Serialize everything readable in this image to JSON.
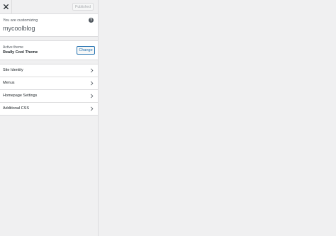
{
  "topbar": {
    "close_icon": "close-icon",
    "published_label": "Published"
  },
  "info": {
    "customizing_label": "You are customizing",
    "site_title": "mycoolblog",
    "help_icon": "help-icon",
    "help_glyph": "?"
  },
  "theme": {
    "active_label": "Active theme",
    "name": "Really Cool Theme",
    "change_label": "Change"
  },
  "menu": {
    "items": [
      {
        "label": "Site Identity",
        "icon": "chevron-right-icon"
      },
      {
        "label": "Menus",
        "icon": "chevron-right-icon"
      },
      {
        "label": "Homepage Settings",
        "icon": "chevron-right-icon"
      },
      {
        "label": "Additional CSS",
        "icon": "chevron-right-icon"
      }
    ]
  },
  "colors": {
    "accent": "#2271b1",
    "panel_bg": "#ffffff",
    "background": "#f0f0f1"
  }
}
